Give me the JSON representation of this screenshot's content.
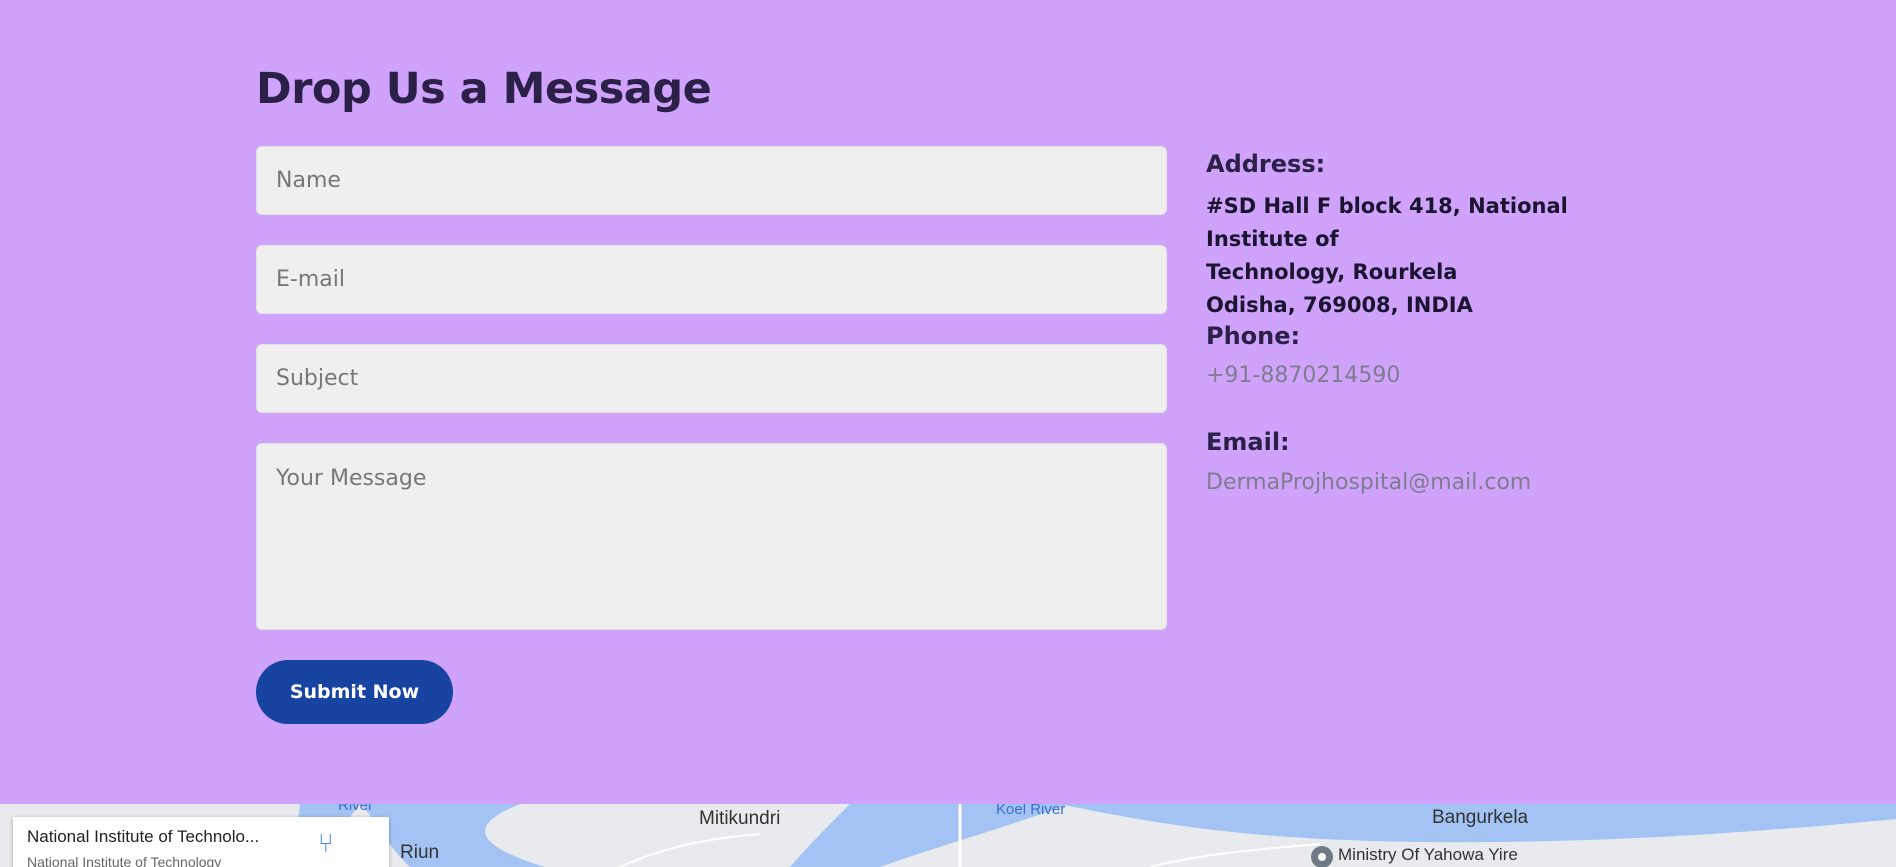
{
  "contact": {
    "heading": "Drop Us a Message",
    "form": {
      "name_placeholder": "Name",
      "email_placeholder": "E-mail",
      "subject_placeholder": "Subject",
      "message_placeholder": "Your Message",
      "submit_label": "Submit Now"
    },
    "info": {
      "address_label": "Address:",
      "address_line1": "#SD Hall F block 418, National Institute of",
      "address_line2": "Technology, Rourkela",
      "address_line3": "Odisha, 769008, INDIA",
      "phone_label": "Phone:",
      "phone_value": "+91-8870214590",
      "email_label": "Email:",
      "email_value": "DermaProjhospital@mail.com"
    }
  },
  "map": {
    "card_title": "National Institute of Technolo...",
    "card_subtitle": "National Institute of Technology",
    "directions_icon": "directions-icon",
    "labels": [
      "Mitikundri",
      "Riun",
      "Bangurkela",
      "Ministry Of Yahowa Yire"
    ],
    "river_labels": [
      "Koel River",
      "River"
    ]
  },
  "colors": {
    "background": "#cfa3fb",
    "heading": "#2a2048",
    "submit_bg": "#1743a1",
    "muted_text": "#7d7d8e"
  }
}
